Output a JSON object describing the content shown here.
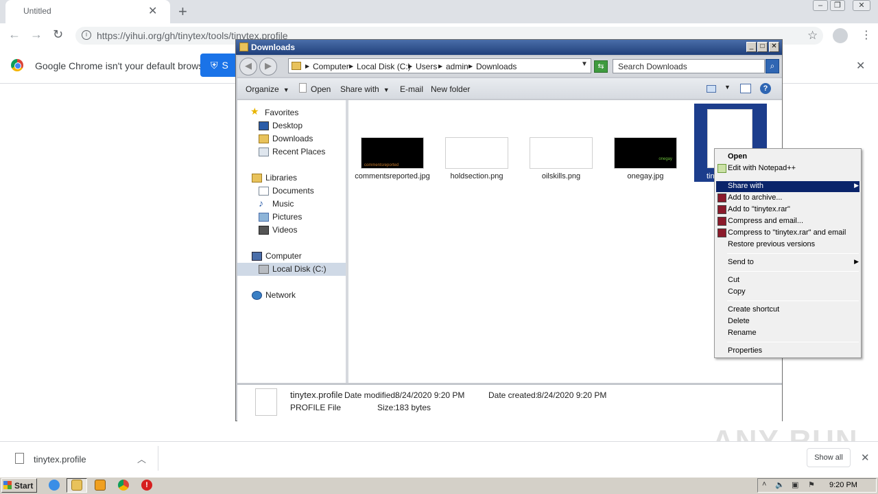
{
  "browser": {
    "tab_title": "Untitled",
    "new_tab_glyph": "+",
    "close_glyph": "✕",
    "url": "https://yihui.org/gh/tinytex/tools/tinytex.profile",
    "infobar_text": "Google Chrome isn't your default browser",
    "infobar_button": "S",
    "icons": [
      "back-icon",
      "forward-icon",
      "reload-icon",
      "info-icon",
      "star-icon",
      "profile-icon",
      "menu-icon"
    ]
  },
  "explorer": {
    "title": "Downloads",
    "breadcrumbs": [
      "Computer",
      "Local Disk (C:)",
      "Users",
      "admin",
      "Downloads"
    ],
    "search_placeholder": "Search Downloads",
    "commands": {
      "organize": "Organize",
      "open": "Open",
      "share_with": "Share with",
      "email": "E-mail",
      "new_folder": "New folder"
    },
    "nav": {
      "favorites": "Favorites",
      "desktop": "Desktop",
      "downloads": "Downloads",
      "recent": "Recent Places",
      "libraries": "Libraries",
      "documents": "Documents",
      "music": "Music",
      "pictures": "Pictures",
      "videos": "Videos",
      "computer": "Computer",
      "local_disk": "Local Disk (C:)",
      "network": "Network"
    },
    "files": [
      {
        "name": "commentsreported.jpg",
        "thumb": "dark",
        "thumb_text": "commentsreported"
      },
      {
        "name": "holdsection.png",
        "thumb": "light",
        "thumb_text": ""
      },
      {
        "name": "oilskills.png",
        "thumb": "light",
        "thumb_text": ""
      },
      {
        "name": "onegay.jpg",
        "thumb": "dark",
        "thumb_text": "onegay"
      },
      {
        "name": "tin",
        "thumb": "doc",
        "thumb_text": ""
      }
    ],
    "details": {
      "filename": "tinytex.profile",
      "type": "PROFILE File",
      "modified_label": "Date modified:",
      "modified": "8/24/2020 9:20 PM",
      "created_label": "Date created:",
      "created": "8/24/2020 9:20 PM",
      "size_label": "Size:",
      "size": "183 bytes"
    }
  },
  "context_menu": {
    "open": "Open",
    "edit_notepad": "Edit with Notepad++",
    "share_with": "Share with",
    "add_archive": "Add to archive...",
    "add_rar": "Add to \"tinytex.rar\"",
    "compress_email": "Compress and email...",
    "compress_rar_email": "Compress to \"tinytex.rar\" and email",
    "restore": "Restore previous versions",
    "send_to": "Send to",
    "cut": "Cut",
    "copy": "Copy",
    "create_shortcut": "Create shortcut",
    "delete": "Delete",
    "rename": "Rename",
    "properties": "Properties"
  },
  "download_shelf": {
    "filename": "tinytex.profile",
    "show_all": "Show all"
  },
  "taskbar": {
    "start": "Start",
    "clock": "9:20 PM"
  },
  "watermark": "ANY RUN",
  "colors": {
    "menu_highlight": "#0a246a",
    "selected_file": "#1c3d8c",
    "chrome_blue": "#1a73e8"
  }
}
